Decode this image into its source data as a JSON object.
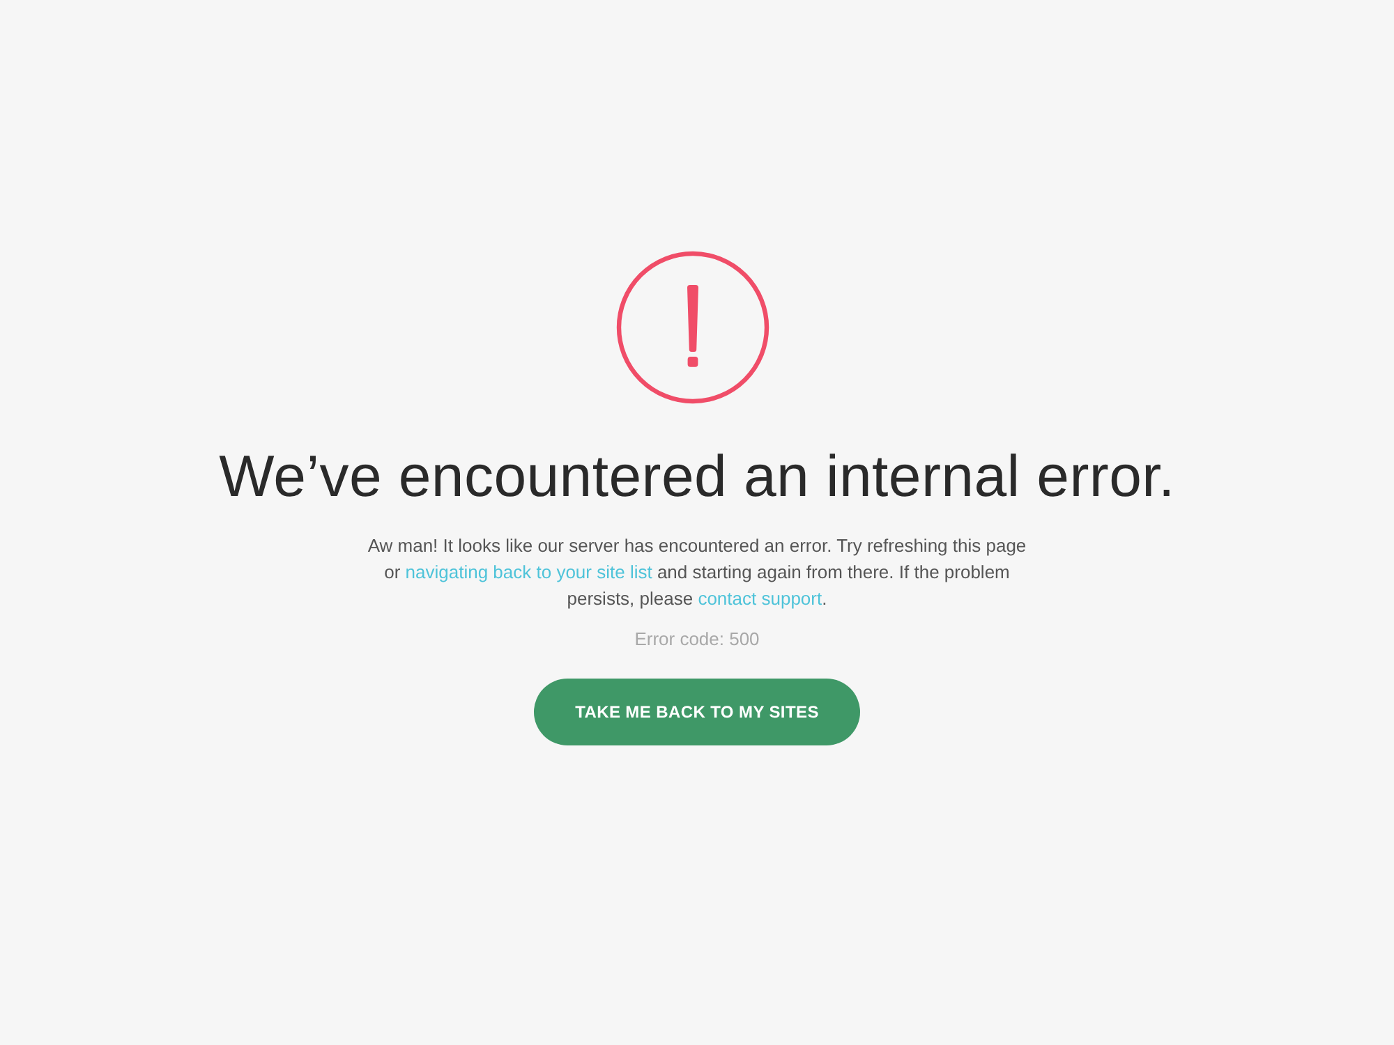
{
  "heading": "We’ve encountered an internal error.",
  "message": [
    {
      "kind": "text",
      "text": "Aw man! It looks like our server has encountered an error. Try refreshing this page or "
    },
    {
      "kind": "link",
      "text": "navigating back to your site list"
    },
    {
      "kind": "text",
      "text": " and starting again from there. If the problem persists, please "
    },
    {
      "kind": "link",
      "text": "contact support"
    },
    {
      "kind": "text",
      "text": "."
    }
  ],
  "error_code": "Error code: 500",
  "button": "TAKE ME BACK TO MY SITES"
}
